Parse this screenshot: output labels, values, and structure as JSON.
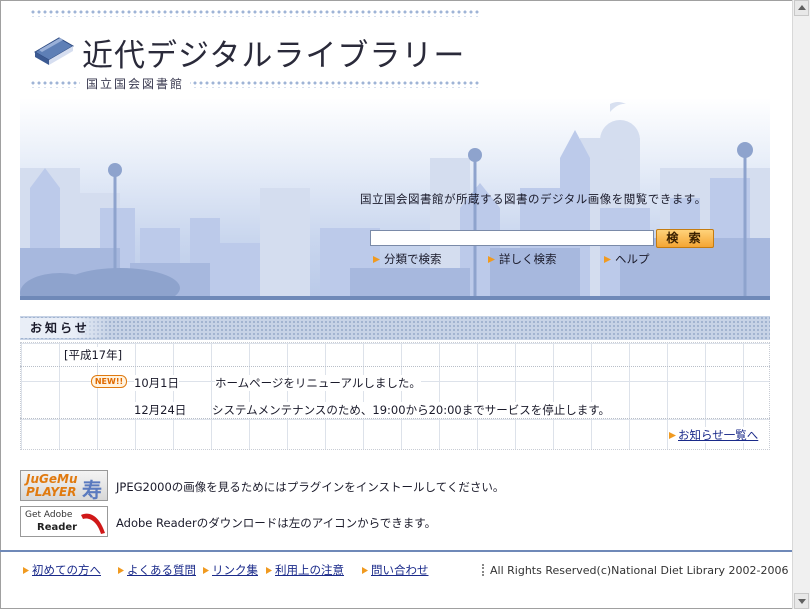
{
  "header": {
    "site_title": "近代デジタルライブラリー",
    "sub_title": "国立国会図書館"
  },
  "hero": {
    "description": "国立国会図書館が所蔵する図書のデジタル画像を閲覧できます。",
    "search": {
      "value": "",
      "placeholder": "",
      "button_label": "検 索"
    },
    "links": [
      {
        "label": "分類で検索"
      },
      {
        "label": "詳しく検索"
      },
      {
        "label": "ヘルプ"
      }
    ]
  },
  "notice": {
    "heading": "お知らせ",
    "year": "[平成17年]",
    "items": [
      {
        "badge": "NEW!!",
        "date": "10月1日",
        "text": "ホームページをリニューアルしました。"
      },
      {
        "badge": "",
        "date": "12月24日",
        "text": "システムメンテナンスのため、19:00から20:00までサービスを停止します。"
      }
    ],
    "more_link": "お知らせ一覧へ"
  },
  "plugins": [
    {
      "icon_name": "jugemu-player-icon",
      "icon_text_1": "JuGeMu",
      "icon_text_2": "PLAYER",
      "icon_text_3": "寿",
      "text": "JPEG2000の画像を見るためにはプラグインをインストールしてください。"
    },
    {
      "icon_name": "adobe-reader-icon",
      "icon_text_1": "Get Adobe",
      "icon_text_2": "Reader",
      "text": "Adobe Readerのダウンロードは左のアイコンからできます。"
    }
  ],
  "footer": {
    "links": [
      {
        "label": "初めての方へ"
      },
      {
        "label": "よくある質問"
      },
      {
        "label": "リンク集"
      },
      {
        "label": "利用上の注意"
      },
      {
        "label": "問い合わせ"
      }
    ],
    "copyright": "All Rights Reserved(c)National Diet Library 2002-2006"
  },
  "colors": {
    "accent": "#6f89b8",
    "link": "#1a2a8a",
    "button": "#f4a534",
    "new_badge": "#e06a00"
  }
}
